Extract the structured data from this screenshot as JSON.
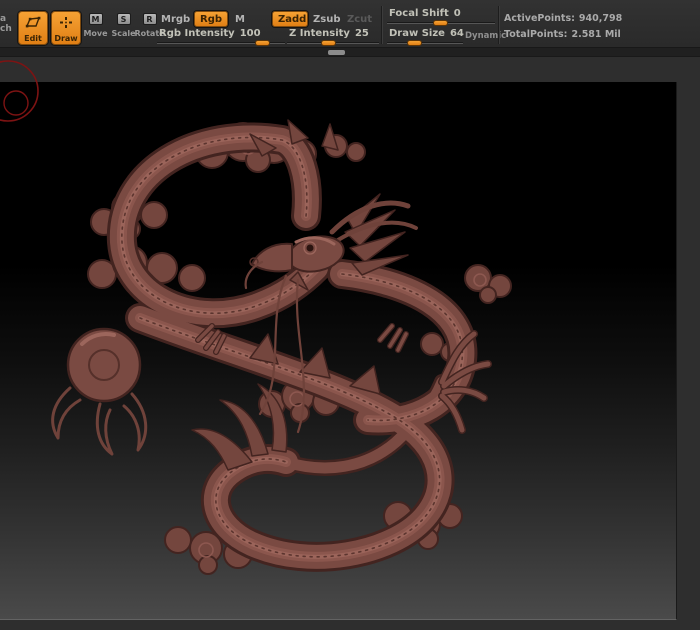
{
  "toolbar": {
    "cropped_button": {
      "fragment_top": "a",
      "fragment_bottom": "ch"
    },
    "edit": {
      "label": "Edit"
    },
    "draw": {
      "label": "Draw"
    },
    "move": {
      "label": "Move",
      "badge": "M"
    },
    "scale": {
      "label": "Scale",
      "badge": "S"
    },
    "rotate": {
      "label": "Rotate",
      "badge": "R"
    },
    "mrgb": "Mrgb",
    "rgb": "Rgb",
    "m": "M",
    "rgb_intensity": {
      "label": "Rgb Intensity",
      "value": "100"
    },
    "zadd": "Zadd",
    "zsub": "Zsub",
    "zcut": "Zcut",
    "z_intensity": {
      "label": "Z Intensity",
      "value": "25"
    },
    "focal_shift": {
      "label": "Focal Shift",
      "value": "0"
    },
    "draw_size": {
      "label": "Draw Size",
      "value": "64"
    },
    "dynamic": "Dynamic",
    "stats": {
      "active_label": "ActivePoints:",
      "active_value": "940,798",
      "total_label": "TotalPoints:",
      "total_value": "2.581 Mil"
    }
  },
  "canvas": {
    "object": "dragon-relief-sculpture",
    "cursor": "brush-cursor-circle"
  },
  "colors": {
    "accent_orange": "#e8891f",
    "toolbar_bg": "#2d2d2d",
    "canvas_top": "#000000",
    "canvas_bottom": "#4a4a4a",
    "sculpt_clay": "#7a4a42",
    "sculpt_highlight": "#9c665c",
    "sculpt_shadow": "#432420",
    "cursor_red": "#7d1313"
  }
}
